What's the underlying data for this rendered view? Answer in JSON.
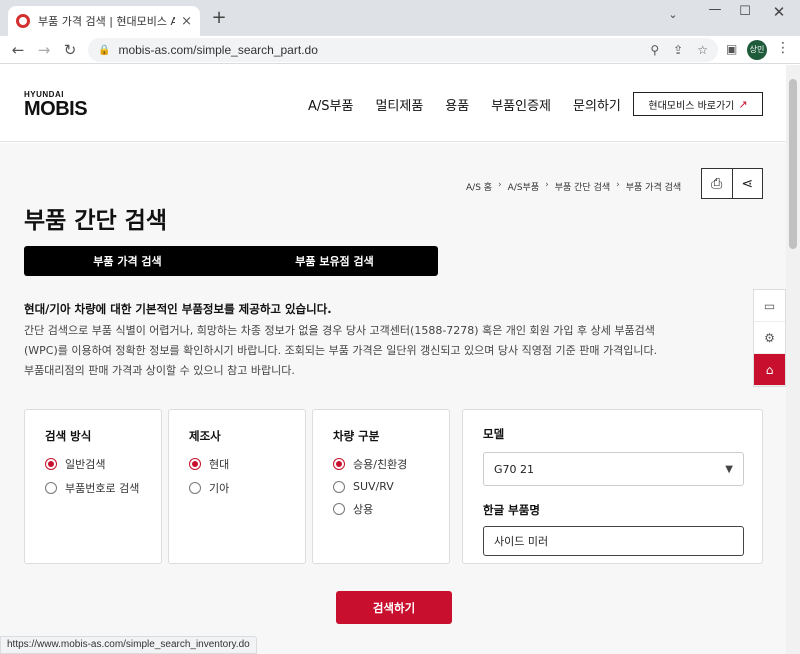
{
  "browser": {
    "tab_title": "부품 가격 검색 | 현대모비스 A/S",
    "tab_close": "×",
    "new_tab": "+",
    "url": "mobis-as.com/simple_search_part.do",
    "profile_initials": "상민",
    "status_url": "https://www.mobis-as.com/simple_search_inventory.do"
  },
  "header": {
    "logo_top": "HYUNDAI",
    "logo_main": "MOBIS",
    "nav": [
      "A/S부품",
      "멀티제품",
      "용품",
      "부품인증제",
      "문의하기"
    ],
    "corp_link": "현대모비스 바로가기",
    "corp_arrow": "↗"
  },
  "breadcrumb": [
    "A/S 홈",
    "A/S부품",
    "부품 간단 검색",
    "부품 가격 검색"
  ],
  "page": {
    "title": "부품 간단 검색",
    "tabs": [
      "부품 가격 검색",
      "부품 보유점 검색"
    ],
    "intro_lead": "현대/기아 차량에 대한 기본적인 부품정보를 제공하고 있습니다.",
    "intro_lines": [
      "간단 검색으로 부품 식별이 어렵거나, 희망하는 차종 정보가 없을 경우 당사 고객센터(1588-7278) 혹은 개인 회원 가입 후 상세 부품검색",
      "(WPC)를 이용하여 정확한 정보를 확인하시기 바랍니다. 조회되는 부품 가격은 일단위 갱신되고 있으며 당사 직영점 기준 판매 가격입니다.",
      "부품대리점의 판매 가격과 상이할 수 있으니 참고 바랍니다."
    ]
  },
  "search": {
    "method": {
      "label": "검색 방식",
      "options": [
        "일반검색",
        "부품번호로 검색"
      ],
      "selected": 0
    },
    "maker": {
      "label": "제조사",
      "options": [
        "현대",
        "기아"
      ],
      "selected": 0
    },
    "vehicle": {
      "label": "차량 구분",
      "options": [
        "승용/친환경",
        "SUV/RV",
        "상용"
      ],
      "selected": 0
    },
    "model": {
      "label": "모델",
      "value": "G70 21"
    },
    "part_name": {
      "label": "한글 부품명",
      "value": "사이드 미러"
    },
    "submit_label": "검색하기"
  },
  "colors": {
    "accent": "#c8102e",
    "tab_bg": "#000000"
  }
}
